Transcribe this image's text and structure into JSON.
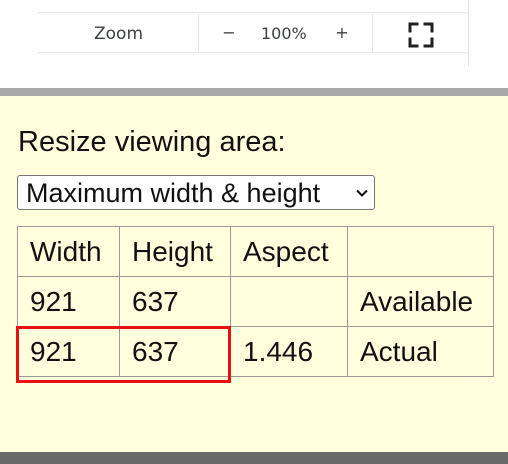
{
  "zoom_menu": {
    "label": "Zoom",
    "decrease_label": "−",
    "value": "100%",
    "increase_label": "+",
    "fullscreen_icon": "fullscreen-icon"
  },
  "resize": {
    "heading": "Resize viewing area:",
    "selected_option": "Maximum width & height",
    "dropdown_icon": "chevron-down-icon",
    "table": {
      "headers": [
        "Width",
        "Height",
        "Aspect",
        ""
      ],
      "rows": [
        [
          "921",
          "637",
          "",
          "Available"
        ],
        [
          "921",
          "637",
          "1.446",
          "Actual"
        ]
      ]
    },
    "highlight_color": "#e81010"
  },
  "colors": {
    "panel_background": "#ffffdd",
    "separator_gray": "#a8a8a8",
    "bottom_bar": "#6a6a6a"
  }
}
